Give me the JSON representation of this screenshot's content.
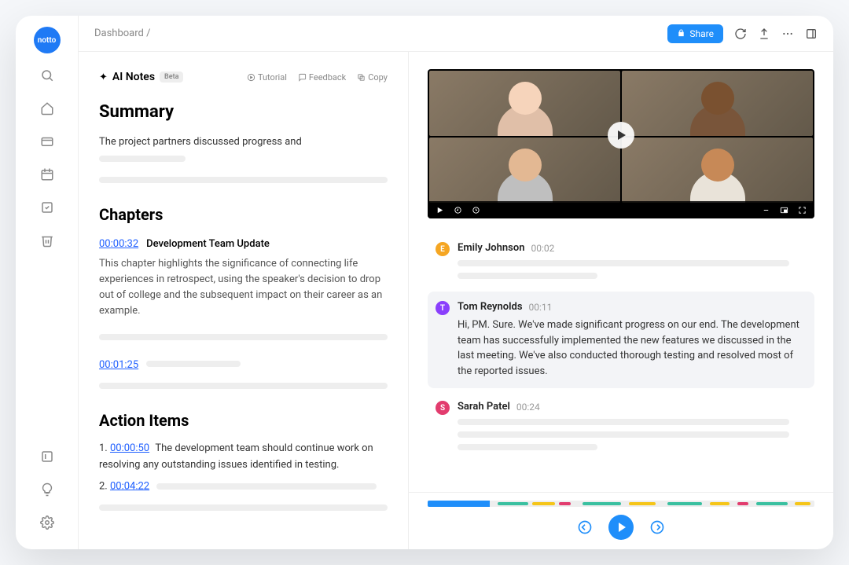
{
  "brand": "notto",
  "breadcrumb": "Dashboard /",
  "topbar": {
    "share": "Share"
  },
  "ainotes": {
    "title": "AI Notes",
    "beta": "Beta",
    "actions": {
      "tutorial": "Tutorial",
      "feedback": "Feedback",
      "copy": "Copy"
    }
  },
  "summary": {
    "heading": "Summary",
    "text": "The  project partners discussed progress and"
  },
  "chapters": {
    "heading": "Chapters",
    "items": [
      {
        "ts": "00:00:32",
        "title": "Development Team Update",
        "body": "This chapter highlights the significance of connecting life experiences in retrospect, using the speaker's decision to drop out of college and the subsequent impact on their career as an example."
      },
      {
        "ts": "00:01:25",
        "title": "",
        "body": ""
      }
    ]
  },
  "action_items": {
    "heading": "Action Items",
    "items": [
      {
        "num": "1.",
        "ts": "00:00:50",
        "text": "The development team should continue work on resolving any outstanding issues identified in testing."
      },
      {
        "num": "2.",
        "ts": "00:04:22",
        "text": ""
      }
    ]
  },
  "transcript": {
    "turns": [
      {
        "speaker": "Emily Johnson",
        "initial": "E",
        "color": "#f5a623",
        "ts": "00:02",
        "text": ""
      },
      {
        "speaker": "Tom Reynolds",
        "initial": "T",
        "color": "#8a3ffc",
        "ts": "00:11",
        "text": "Hi, PM. Sure. We've made significant progress on our end. The development team has successfully implemented the new features we discussed in the last meeting. We've also conducted thorough testing and resolved most of the reported issues."
      },
      {
        "speaker": "Sarah Patel",
        "initial": "S",
        "color": "#e23c6e",
        "ts": "00:24",
        "text": ""
      }
    ]
  },
  "timeline_segments": [
    {
      "left": "18%",
      "width": "8%",
      "color": "#3ac0a0"
    },
    {
      "left": "27%",
      "width": "6%",
      "color": "#f5c518"
    },
    {
      "left": "34%",
      "width": "3%",
      "color": "#e23c6e"
    },
    {
      "left": "40%",
      "width": "10%",
      "color": "#3ac0a0"
    },
    {
      "left": "52%",
      "width": "7%",
      "color": "#f5c518"
    },
    {
      "left": "62%",
      "width": "9%",
      "color": "#3ac0a0"
    },
    {
      "left": "73%",
      "width": "5%",
      "color": "#f5c518"
    },
    {
      "left": "80%",
      "width": "3%",
      "color": "#e23c6e"
    },
    {
      "left": "85%",
      "width": "8%",
      "color": "#3ac0a0"
    },
    {
      "left": "95%",
      "width": "4%",
      "color": "#f5c518"
    }
  ]
}
